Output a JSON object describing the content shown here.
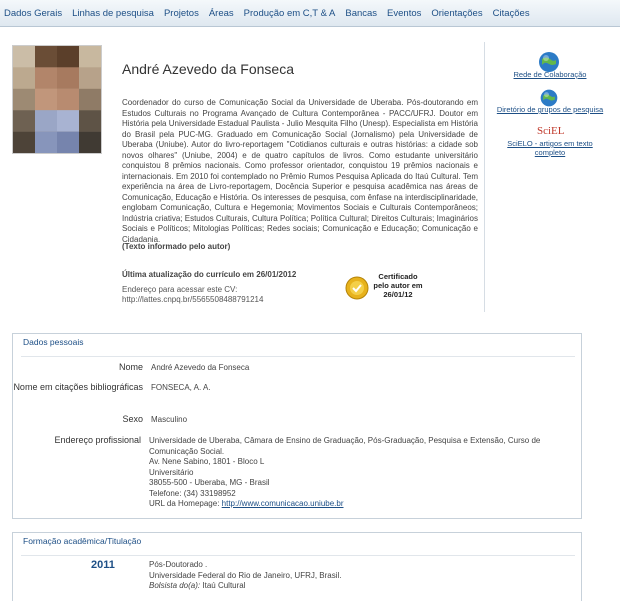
{
  "nav": {
    "items": [
      "Dados Gerais",
      "Linhas de pesquisa",
      "Projetos",
      "Áreas",
      "Produção em C,T & A",
      "Bancas",
      "Eventos",
      "Orientações",
      "Citações"
    ]
  },
  "profile": {
    "name": "André Azevedo da Fonseca",
    "bio": "Coordenador do curso de Comunicação Social da Universidade de Uberaba. Pós-doutorando em Estudos Culturais no Programa Avançado de Cultura Contemporânea - PACC/UFRJ. Doutor em História pela Universidade Estadual Paulista - Julio Mesquita Filho (Unesp). Especialista em História do Brasil pela PUC-MG. Graduado em Comunicação Social (Jornalismo) pela Universidade de Uberaba (Uniube). Autor do livro-reportagem \"Cotidianos culturais e outras histórias: a cidade sob novos olhares\" (Uniube, 2004) e de quatro capítulos de livros. Como estudante universitário conquistou 8 prêmios nacionais. Como professor orientador, conquistou 19 prêmios nacionais e internacionais. Em 2010 foi contemplado no Prêmio Rumos Pesquisa Aplicada do Itaú Cultural. Tem experiência na área de Livro-reportagem, Docência Superior e pesquisa acadêmica nas áreas de Comunicação, Educação e História. Os interesses de pesquisa, com ênfase na interdisciplinaridade, englobam Comunicação, Cultura e Hegemonia; Movimentos Sociais e Culturais Contemporâneos; Indústria criativa; Estudos Culturais, Cultura Política; Política Cultural; Direitos Culturais; Imaginários Sociais e Políticos; Mitologias Políticas; Redes sociais; Comunicação e Educação; Comunicação e Cidadania.",
    "bio_note": "(Texto informado pelo autor)",
    "last_update": "Última atualização do currículo em 26/01/2012",
    "address_label": "Endereço para acessar este CV:",
    "address_url": "http://lattes.cnpq.br/5565508488791214",
    "certificate": {
      "line1": "Certificado",
      "line2": "pelo autor em",
      "line3": "26/01/12"
    }
  },
  "sidebar": {
    "links": [
      {
        "label": "Rede de Colaboração",
        "icon": "globe-icon"
      },
      {
        "label": "Diretório de grupos de pesquisa",
        "icon": "globe-icon"
      },
      {
        "label": "SciELO - artigos em texto completo",
        "icon": "scielo-logo"
      }
    ]
  },
  "personal": {
    "title": "Dados pessoais",
    "rows": [
      {
        "label": "Nome",
        "value": "André Azevedo da Fonseca"
      },
      {
        "label": "Nome em citações bibliográficas",
        "value": "FONSECA, A. A."
      },
      {
        "label": "Sexo",
        "value": "Masculino"
      },
      {
        "label": "Endereço profissional",
        "value": "Universidade de Uberaba, Câmara de Ensino de Graduação, Pós-Graduação, Pesquisa e Extensão, Curso de Comunicação Social."
      }
    ],
    "address_lines": [
      "Av. Nene Sabino, 1801 - Bloco L",
      "Universitário",
      "38055-500 - Uberaba, MG - Brasil",
      "Telefone: (34) 33198952"
    ],
    "homepage_label": "URL da Homepage:",
    "homepage_url": "http://www.comunicacao.uniube.br"
  },
  "formation": {
    "title": "Formação acadêmica/Titulação",
    "year": "2011",
    "degree": "Pós-Doutorado .",
    "institution": "Universidade Federal do Rio de Janeiro, UFRJ, Brasil.",
    "scholar_label": "Bolsista do(a):",
    "scholar_value": "Itaú Cultural"
  },
  "colors": {
    "accent": "#1d4f86",
    "border": "#c7d1da",
    "nav_bg": "#e6eef5"
  }
}
